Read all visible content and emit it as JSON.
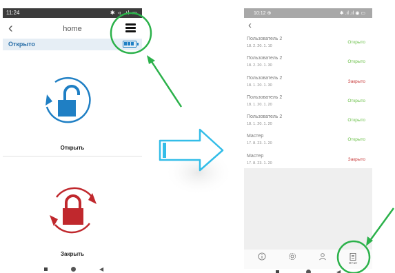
{
  "left_phone": {
    "status": {
      "time": "11:24",
      "icons": "✱ ◃ .ıl ▭"
    },
    "header": {
      "title": "home"
    },
    "status_bar": {
      "label": "Открыто"
    },
    "open_action": {
      "label": "Открыть"
    },
    "close_action": {
      "label": "Закрыть"
    }
  },
  "right_phone": {
    "status": {
      "time": "10:12 ⊕",
      "icons": "✱ .ıl .ıl ◉ ▭"
    },
    "log": [
      {
        "user": "Пользователь 2",
        "time": "18. 2. 20. 1. 10",
        "state": "Открыто",
        "kind": "open"
      },
      {
        "user": "Пользователь 2",
        "time": "18. 2. 20. 1. 30",
        "state": "Открыто",
        "kind": "open"
      },
      {
        "user": "Пользователь 2",
        "time": "18. 1. 20. 1. 30",
        "state": "Закрыто",
        "kind": "close"
      },
      {
        "user": "Пользователь 2",
        "time": "18. 1. 20. 1. 20",
        "state": "Открыто",
        "kind": "open"
      },
      {
        "user": "Пользователь 2",
        "time": "18. 1. 20. 1. 20",
        "state": "Открыто",
        "kind": "open"
      },
      {
        "user": "Мастер",
        "time": "17. 8. 23. 1. 20",
        "state": "Открыто",
        "kind": "open"
      },
      {
        "user": "Мастер",
        "time": "17. 8. 23. 1. 20",
        "state": "Закрыто",
        "kind": "close"
      }
    ],
    "tabbar": {
      "report_label": "Отчет"
    }
  },
  "colors": {
    "accent_blue": "#1f7fc4",
    "lock_red": "#c0282d",
    "highlight_green": "#2bb14a",
    "open_green": "#6cc04a",
    "close_red": "#c83c3c"
  }
}
